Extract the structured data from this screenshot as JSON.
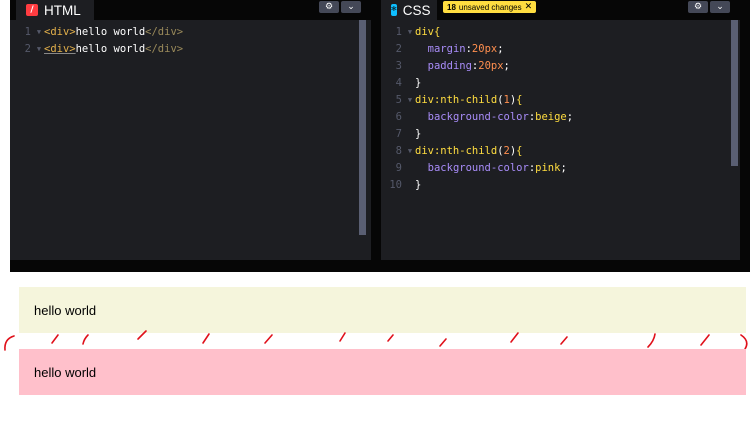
{
  "editor": {
    "html_pane": {
      "title": "HTML",
      "icon": "html-icon",
      "settings_icon": "gear-icon",
      "menu_icon": "chevron-down-icon",
      "lines": [
        {
          "no": "1",
          "open": "<div>",
          "text": "hello world",
          "close": "</div>"
        },
        {
          "no": "2",
          "open": "<div>",
          "text": "hello world",
          "close": "</div>"
        }
      ]
    },
    "css_pane": {
      "title": "CSS",
      "icon": "css-icon",
      "unsaved_count": "18",
      "unsaved_label": "unsaved changes",
      "settings_icon": "gear-icon",
      "menu_icon": "chevron-down-icon",
      "lines": [
        {
          "no": "1",
          "text": "div{"
        },
        {
          "no": "2",
          "prop": "margin",
          "value": "20px"
        },
        {
          "no": "3",
          "prop": "padding",
          "value": "20px"
        },
        {
          "no": "4",
          "text": "}"
        },
        {
          "no": "5",
          "selector": "div:nth-child",
          "arg": "1",
          "tail": "{"
        },
        {
          "no": "6",
          "prop": "background-color",
          "value": "beige"
        },
        {
          "no": "7",
          "text": "}"
        },
        {
          "no": "8",
          "selector": "div:nth-child",
          "arg": "2",
          "tail": "{"
        },
        {
          "no": "9",
          "prop": "background-color",
          "value": "pink"
        },
        {
          "no": "10",
          "text": "}"
        }
      ]
    }
  },
  "preview": {
    "items": [
      {
        "text": "hello world",
        "color": "#f5f5dc"
      },
      {
        "text": "hello world",
        "color": "#ffc0cb"
      }
    ]
  },
  "colors": {
    "editor_bg": "#1d1e22",
    "chrome_bg": "#060606",
    "badge_bg": "#ffdd40",
    "annotation": "#e0101a"
  }
}
